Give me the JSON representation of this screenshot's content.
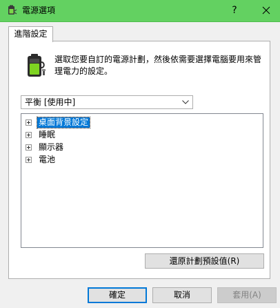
{
  "window": {
    "title": "電源選項",
    "help_label": "?",
    "icon": "power-options-icon",
    "titlebar_color": "#63d161"
  },
  "tabs": [
    {
      "label": "進階設定",
      "active": true
    }
  ],
  "description": "選取您要自訂的電源計劃，然後依需要選擇電腦要用來管理電力的設定。",
  "plan_select": {
    "selected": "平衡 [使用中]"
  },
  "tree_items": [
    {
      "label": "桌面背景設定",
      "selected": true
    },
    {
      "label": "睡眠",
      "selected": false
    },
    {
      "label": "顯示器",
      "selected": false
    },
    {
      "label": "電池",
      "selected": false
    }
  ],
  "restore_button": "還原計劃預設值(R)",
  "buttons": {
    "ok": "確定",
    "cancel": "取消",
    "apply": "套用(A)",
    "apply_enabled": false
  },
  "colors": {
    "selection": "#0078d7",
    "default_button_border": "#0078d7"
  }
}
